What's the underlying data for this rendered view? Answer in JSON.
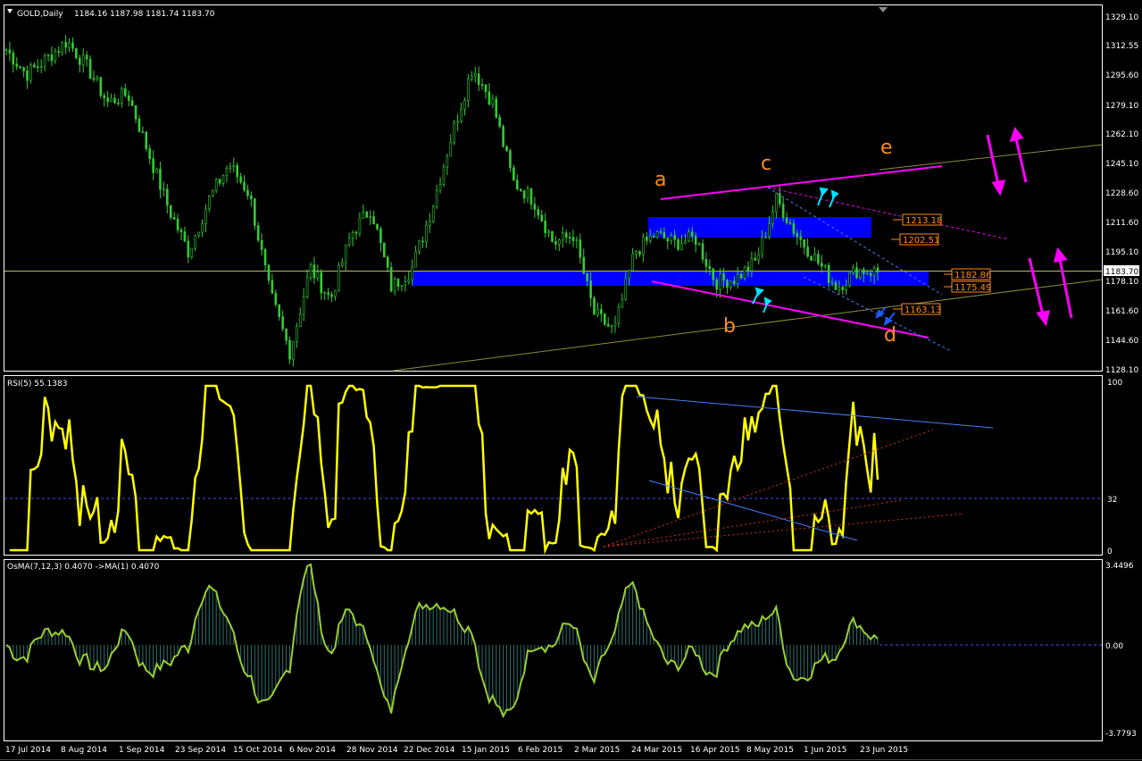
{
  "header": {
    "symbol": "GOLD,Daily",
    "ohlc": "1184.16 1187.98 1181.74 1183.70"
  },
  "price_axis": [
    "1329.10",
    "1312.55",
    "1295.60",
    "1279.10",
    "1262.10",
    "1245.10",
    "1228.60",
    "1211.60",
    "1195.10",
    "1178.10",
    "1161.60",
    "1144.60",
    "1128.10"
  ],
  "current_price": "1183.70",
  "price_markers": [
    "1213.18",
    "1202.51",
    "1182.86",
    "1175.49",
    "1163.13"
  ],
  "wave_labels": [
    "a",
    "b",
    "c",
    "d",
    "e"
  ],
  "rsi_panel": {
    "title": "RSI(5) 55.1383",
    "axis": [
      "100",
      "32",
      "0"
    ],
    "level": 32
  },
  "osma_panel": {
    "title": "OsMA(7,12,3) 0.4070  ->MA(1) 0.4070",
    "axis": [
      "3.4496",
      "0.00",
      "-3.7793"
    ]
  },
  "date_axis": [
    "17 Jul 2014",
    "8 Aug 2014",
    "1 Sep 2014",
    "23 Sep 2014",
    "15 Oct 2014",
    "6 Nov 2014",
    "28 Nov 2014",
    "22 Dec 2014",
    "15 Jan 2015",
    "6 Feb 2015",
    "2 Mar 2015",
    "24 Mar 2015",
    "16 Apr 2015",
    "8 May 2015",
    "1 Jun 2015",
    "23 Jun 2015"
  ],
  "colors": {
    "candles": "#33cc33",
    "rsi": "#ffff00",
    "osma": "#9acd32",
    "zones": "#0000ff",
    "channel": "#ff00ff",
    "trendline": "#8b8b3a",
    "wave_labels": "#ff8c1a",
    "arrows_cyan": "#00e5ff",
    "arrows_magenta": "#ff00ff"
  },
  "chart_data": {
    "type": "candlestick",
    "title": "GOLD,Daily",
    "ylim": [
      1128.1,
      1329.1
    ],
    "zones": [
      {
        "from": 1202.51,
        "to": 1213.18
      },
      {
        "from": 1175.49,
        "to": 1182.86
      }
    ],
    "close_series": [
      {
        "date": "17 Jul 2014",
        "close": 1310
      },
      {
        "date": "25 Jul 2014",
        "close": 1296
      },
      {
        "date": "1 Aug 2014",
        "close": 1305
      },
      {
        "date": "8 Aug 2014",
        "close": 1315
      },
      {
        "date": "15 Aug 2014",
        "close": 1300
      },
      {
        "date": "22 Aug 2014",
        "close": 1280
      },
      {
        "date": "1 Sep 2014",
        "close": 1285
      },
      {
        "date": "10 Sep 2014",
        "close": 1252
      },
      {
        "date": "23 Sep 2014",
        "close": 1220
      },
      {
        "date": "3 Oct 2014",
        "close": 1195
      },
      {
        "date": "10 Oct 2014",
        "close": 1225
      },
      {
        "date": "15 Oct 2014",
        "close": 1245
      },
      {
        "date": "24 Oct 2014",
        "close": 1228
      },
      {
        "date": "31 Oct 2014",
        "close": 1172
      },
      {
        "date": "6 Nov 2014",
        "close": 1138
      },
      {
        "date": "14 Nov 2014",
        "close": 1186
      },
      {
        "date": "28 Nov 2014",
        "close": 1168
      },
      {
        "date": "5 Dec 2014",
        "close": 1205
      },
      {
        "date": "12 Dec 2014",
        "close": 1220
      },
      {
        "date": "22 Dec 2014",
        "close": 1175
      },
      {
        "date": "2 Jan 2015",
        "close": 1185
      },
      {
        "date": "9 Jan 2015",
        "close": 1220
      },
      {
        "date": "15 Jan 2015",
        "close": 1262
      },
      {
        "date": "22 Jan 2015",
        "close": 1300
      },
      {
        "date": "30 Jan 2015",
        "close": 1280
      },
      {
        "date": "6 Feb 2015",
        "close": 1235
      },
      {
        "date": "13 Feb 2015",
        "close": 1225
      },
      {
        "date": "20 Feb 2015",
        "close": 1200
      },
      {
        "date": "2 Mar 2015",
        "close": 1205
      },
      {
        "date": "10 Mar 2015",
        "close": 1160
      },
      {
        "date": "17 Mar 2015",
        "close": 1150
      },
      {
        "date": "24 Mar 2015",
        "close": 1195
      },
      {
        "date": "1 Apr 2015",
        "close": 1205
      },
      {
        "date": "8 Apr 2015",
        "close": 1200
      },
      {
        "date": "16 Apr 2015",
        "close": 1203
      },
      {
        "date": "24 Apr 2015",
        "close": 1178
      },
      {
        "date": "1 May 2015",
        "close": 1180
      },
      {
        "date": "8 May 2015",
        "close": 1190
      },
      {
        "date": "15 May 2015",
        "close": 1225
      },
      {
        "date": "22 May 2015",
        "close": 1205
      },
      {
        "date": "1 Jun 2015",
        "close": 1190
      },
      {
        "date": "8 Jun 2015",
        "close": 1175
      },
      {
        "date": "16 Jun 2015",
        "close": 1185
      },
      {
        "date": "23 Jun 2015",
        "close": 1183.7
      }
    ]
  }
}
